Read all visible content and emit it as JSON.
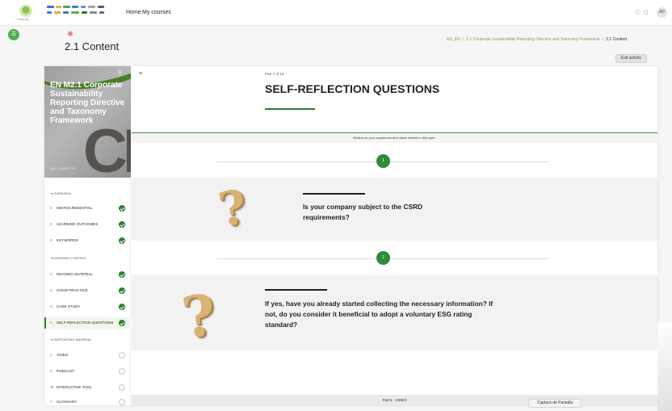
{
  "topbar": {
    "logo_caption": "SUSSLAB",
    "nav": [
      "Home",
      "My courses"
    ],
    "icons": [
      "bell-icon",
      "chat-icon"
    ],
    "avatar_initials": "AD"
  },
  "header": {
    "page_title": "2.1 Content",
    "breadcrumb": [
      "M2_EN",
      "2.1 Corporate Sustainability Reporting Directive and Taxonomy Framework",
      "2.1 Content"
    ],
    "exit_button": "Exit activity"
  },
  "sidebar": {
    "cover_title": "EN M2.1 Corporate Sustainability Reporting Directive and Taxonomy Framework",
    "cover_letters": "CL",
    "cover_progress": "64% COMPLETE",
    "sections": [
      {
        "title": "Overview",
        "items": [
          {
            "label": "Microcredential",
            "icon": "list-icon",
            "done": true
          },
          {
            "label": "Learning outcomes",
            "icon": "list-icon",
            "done": true
          },
          {
            "label": "Keywords",
            "icon": "list-icon",
            "done": true
          }
        ]
      },
      {
        "title": "Learning content",
        "items": [
          {
            "label": "Reading material",
            "icon": "list-icon",
            "done": true
          },
          {
            "label": "Good practice",
            "icon": "list-icon",
            "done": true
          },
          {
            "label": "Case study",
            "icon": "list-icon",
            "done": true
          },
          {
            "label": "Self-reflection questions",
            "icon": "list-icon",
            "done": true,
            "active": true
          }
        ]
      },
      {
        "title": "Supporting material",
        "items": [
          {
            "label": "Video",
            "icon": "video-icon",
            "done": false
          },
          {
            "label": "Podcast",
            "icon": "list-icon",
            "done": false
          },
          {
            "label": "Interactive tool",
            "icon": "tool-icon",
            "done": false
          },
          {
            "label": "Glossary",
            "icon": "list-icon",
            "done": false
          }
        ]
      }
    ]
  },
  "main": {
    "part_label": "Part 7 of 13",
    "section_title": "SELF-REFLECTION QUESTIONS",
    "intro": "Reflect on your experience and views related to this topic.",
    "questions": [
      {
        "number": "1",
        "text": "Is your company subject to the CSRD requirements?"
      },
      {
        "number": "2",
        "text": "If yes, have you already started collecting the necessary information? If not, do you consider it beneficial to adopt a voluntary ESG rating standard?"
      }
    ],
    "footer_next": "Part 8 - VIDEO"
  },
  "toast": "Captura de Pantalla",
  "colors": {
    "accent": "#2e7d32",
    "badge": "#2e8b3a",
    "breadcrumb_link": "#7ba34a"
  }
}
